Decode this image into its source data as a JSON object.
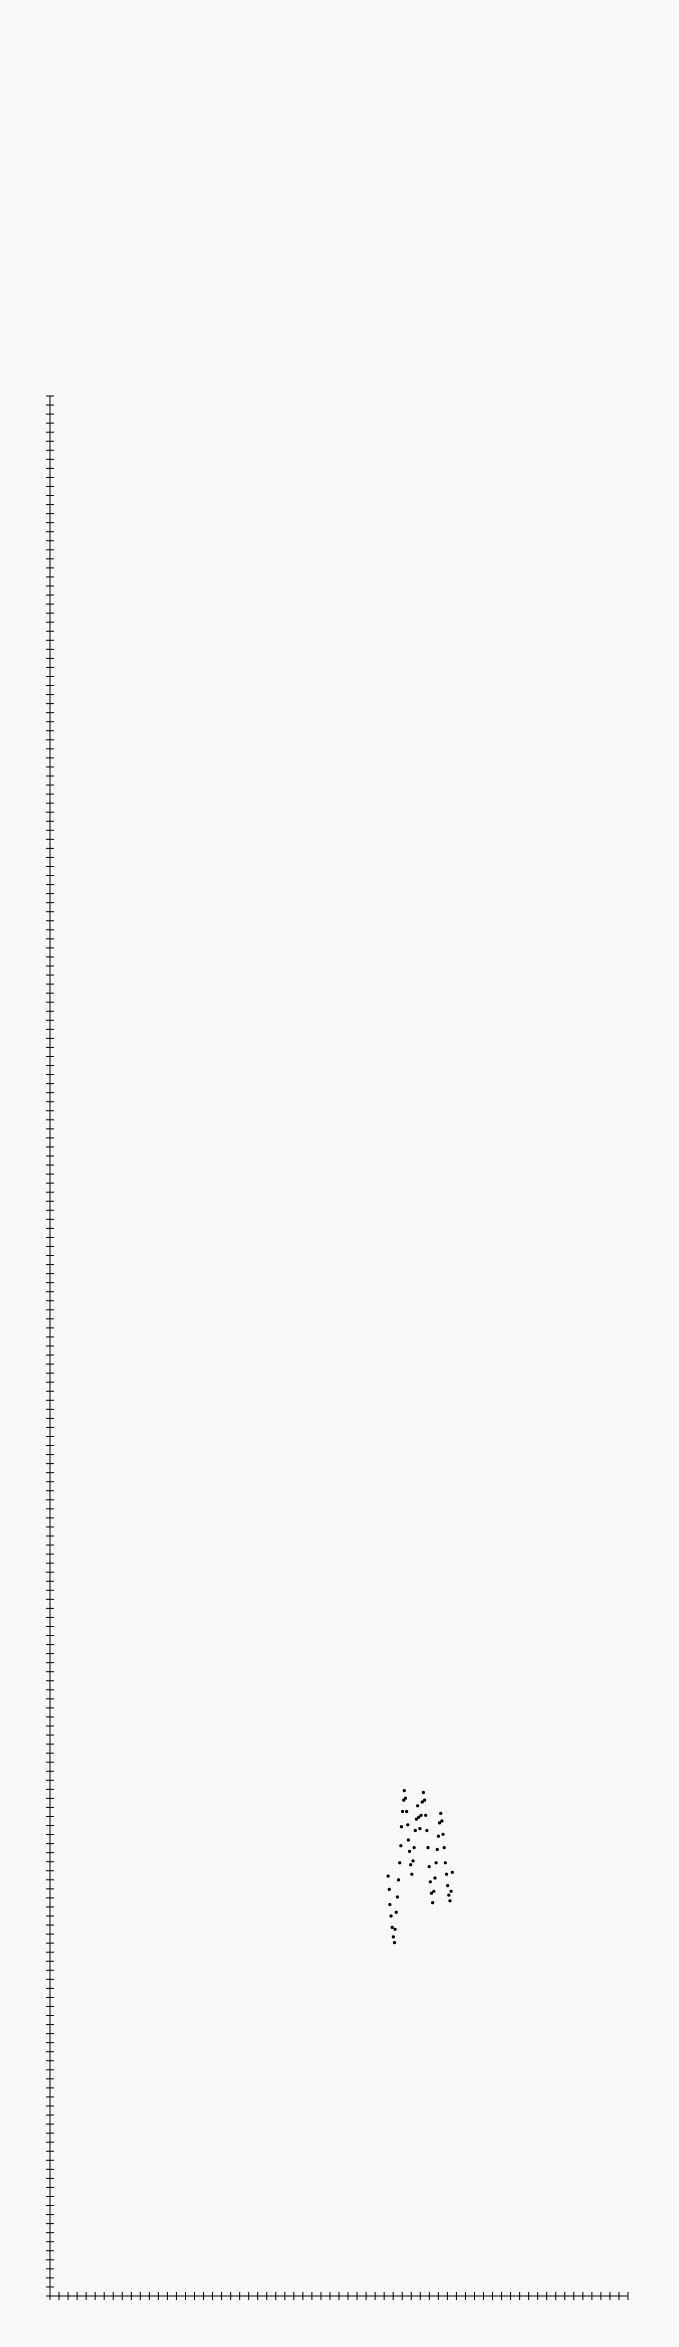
{
  "chart_data": {
    "type": "scatter",
    "title": "",
    "xlabel": "",
    "ylabel": "",
    "xlim": [
      0,
      100
    ],
    "ylim": [
      0,
      100
    ],
    "x_minor_ticks": 64,
    "y_minor_ticks": 210,
    "grid": false,
    "legend": "none",
    "marker_color": "#000000",
    "background": "#f9f9f9",
    "series": [
      {
        "points": [
          [
            58.5,
            22.1
          ],
          [
            58.7,
            21.4
          ],
          [
            58.8,
            20.6
          ],
          [
            59.0,
            20.0
          ],
          [
            59.2,
            19.4
          ],
          [
            59.4,
            18.9
          ],
          [
            59.6,
            18.6
          ],
          [
            59.7,
            19.3
          ],
          [
            59.9,
            20.2
          ],
          [
            60.1,
            21.0
          ],
          [
            60.3,
            21.9
          ],
          [
            60.5,
            22.8
          ],
          [
            60.7,
            23.7
          ],
          [
            60.8,
            24.7
          ],
          [
            61.0,
            25.5
          ],
          [
            61.2,
            26.1
          ],
          [
            61.3,
            26.6
          ],
          [
            61.5,
            26.2
          ],
          [
            61.7,
            25.5
          ],
          [
            61.9,
            24.8
          ],
          [
            62.0,
            24.0
          ],
          [
            62.2,
            23.4
          ],
          [
            62.4,
            22.7
          ],
          [
            62.6,
            22.2
          ],
          [
            62.8,
            22.9
          ],
          [
            63.0,
            23.6
          ],
          [
            63.2,
            24.5
          ],
          [
            63.4,
            25.1
          ],
          [
            63.6,
            25.8
          ],
          [
            63.8,
            25.2
          ],
          [
            64.0,
            24.6
          ],
          [
            64.2,
            25.3
          ],
          [
            64.4,
            26.0
          ],
          [
            64.6,
            26.5
          ],
          [
            64.8,
            26.1
          ],
          [
            65.0,
            25.3
          ],
          [
            65.2,
            24.5
          ],
          [
            65.4,
            23.6
          ],
          [
            65.6,
            22.6
          ],
          [
            65.8,
            21.8
          ],
          [
            66.0,
            21.2
          ],
          [
            66.2,
            20.7
          ],
          [
            66.4,
            21.3
          ],
          [
            66.6,
            22.0
          ],
          [
            66.8,
            22.8
          ],
          [
            67.0,
            23.5
          ],
          [
            67.2,
            24.2
          ],
          [
            67.4,
            24.9
          ],
          [
            67.6,
            25.4
          ],
          [
            67.8,
            25.0
          ],
          [
            68.0,
            24.3
          ],
          [
            68.2,
            23.6
          ],
          [
            68.4,
            22.8
          ],
          [
            68.6,
            22.2
          ],
          [
            68.8,
            21.6
          ],
          [
            69.0,
            21.1
          ],
          [
            69.2,
            20.8
          ],
          [
            69.4,
            21.3
          ],
          [
            69.6,
            22.3
          ]
        ]
      }
    ]
  }
}
